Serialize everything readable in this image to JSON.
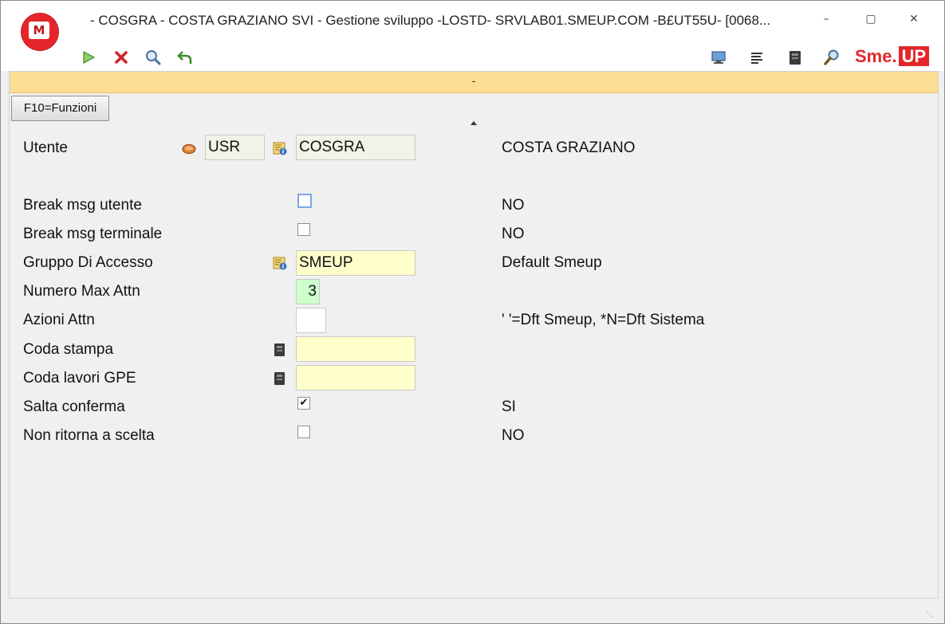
{
  "window": {
    "title": "- COSGRA - COSTA GRAZIANO SVI - Gestione sviluppo -LOSTD- SRVLAB01.SMEUP.COM -B£UT55U- [0068...",
    "logo_text": "M",
    "minimize_glyph": "–",
    "maximize_glyph": "▢",
    "close_glyph": "✕"
  },
  "toolbar": {
    "left_icons": [
      "play-icon",
      "cancel-icon",
      "search-icon",
      "undo-icon"
    ],
    "right_icons": [
      "monitor-icon",
      "list-icon",
      "printer-icon",
      "magnifier-icon"
    ],
    "brand_sme": "Sme.",
    "brand_up": "UP"
  },
  "banner": {
    "text": "-"
  },
  "function_button": {
    "label": "F10=Funzioni"
  },
  "form": {
    "utente": {
      "label": "Utente",
      "type_code": "USR",
      "value": "COSGRA",
      "description": "COSTA GRAZIANO"
    },
    "break_msg_utente": {
      "label": "Break msg utente",
      "checked": false,
      "description": "NO"
    },
    "break_msg_terminale": {
      "label": "Break msg terminale",
      "checked": false,
      "description": "NO"
    },
    "gruppo_accesso": {
      "label": "Gruppo Di Accesso",
      "value": "SMEUP",
      "description": "Default Smeup"
    },
    "numero_max_attn": {
      "label": "Numero Max Attn",
      "value": "3"
    },
    "azioni_attn": {
      "label": "Azioni Attn",
      "value": "",
      "description": "' '=Dft Smeup, *N=Dft Sistema"
    },
    "coda_stampa": {
      "label": "Coda stampa",
      "value": ""
    },
    "coda_lavori_gpe": {
      "label": "Coda lavori GPE",
      "value": ""
    },
    "salta_conferma": {
      "label": "Salta conferma",
      "checked": true,
      "check_glyph": "✔",
      "description": "SI"
    },
    "non_ritorna_scelta": {
      "label": "Non ritorna a scelta",
      "checked": false,
      "description": "NO"
    }
  },
  "colors": {
    "banner": "#fddc94",
    "brand": "#e4262a",
    "field_yellow": "#ffffcc",
    "field_green": "#ccffcc",
    "field_beige": "#f2f3e6"
  }
}
